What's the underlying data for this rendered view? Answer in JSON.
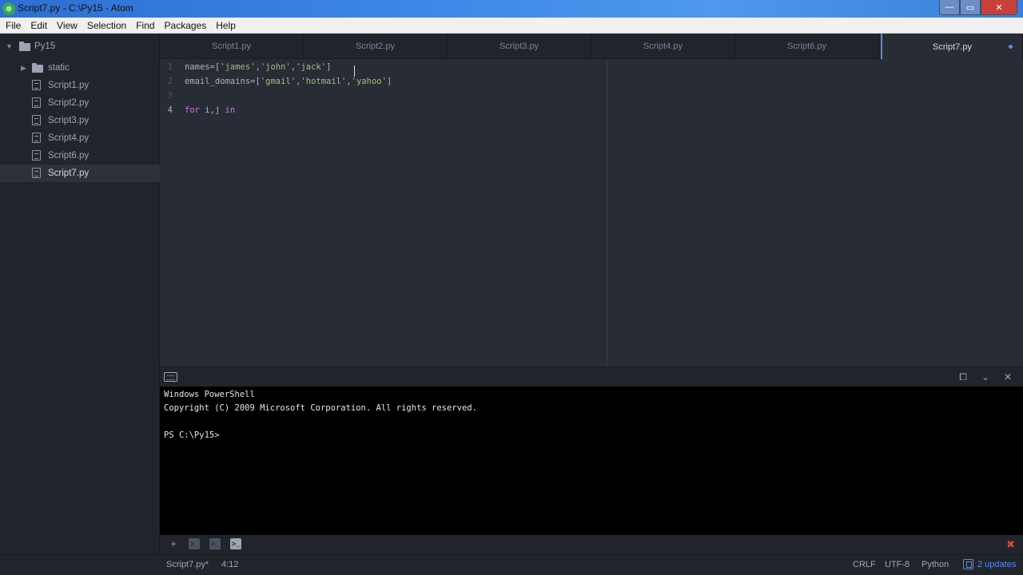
{
  "window": {
    "title": "Script7.py - C:\\Py15 - Atom",
    "min_glyph": "—",
    "max_glyph": "▭",
    "close_glyph": "✕"
  },
  "menu": [
    "File",
    "Edit",
    "View",
    "Selection",
    "Find",
    "Packages",
    "Help"
  ],
  "tree": {
    "root": "Py15",
    "folder": "static",
    "files": [
      "Script1.py",
      "Script2.py",
      "Script3.py",
      "Script4.py",
      "Script6.py",
      "Script7.py"
    ],
    "selected": "Script7.py"
  },
  "tabs": [
    "Script1.py",
    "Script2.py",
    "Script3.py",
    "Script4.py",
    "Script6.py",
    "Script7.py"
  ],
  "active_tab": "Script7.py",
  "editor": {
    "line_numbers": [
      "1",
      "2",
      "3",
      "4"
    ],
    "line1": {
      "pre": "names=[",
      "s1": "'james'",
      "c1": ",",
      "s2": "'john'",
      "c2": ",",
      "s3": "'jack'",
      "post": "]"
    },
    "line2": {
      "pre": "email_domains=[",
      "s1": "'gmail'",
      "c1": ",",
      "s2": "'hotmail'",
      "c2": ",",
      "s3": "'yahoo'",
      "post": "]"
    },
    "line4": {
      "kw1": "for",
      "mid": " i,j ",
      "kw2": "in"
    }
  },
  "terminal": {
    "lines": [
      "Windows PowerShell",
      "Copyright (C) 2009 Microsoft Corporation. All rights reserved.",
      "",
      "PS C:\\Py15>"
    ]
  },
  "terminal_controls": {
    "maximize": "⧠",
    "collapse": "⌄",
    "close": "✕"
  },
  "terminal_toolbar": {
    "add": "+",
    "close_all": "✖"
  },
  "status": {
    "file": "Script7.py*",
    "cursor": "4:12",
    "line_ending": "CRLF",
    "encoding": "UTF-8",
    "grammar": "Python",
    "updates": "2 updates"
  },
  "colors": {
    "accent": "#568af2",
    "string": "#98c379",
    "keyword": "#c678dd",
    "terminal_close": "#e0433c"
  }
}
